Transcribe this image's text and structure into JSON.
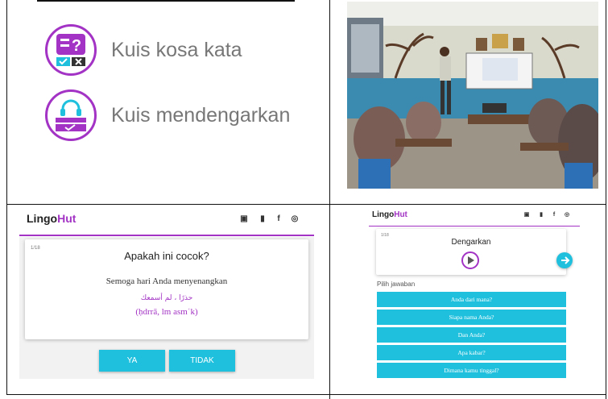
{
  "quiz_menu": {
    "items": [
      {
        "label": "Kuis kosa kata",
        "icon": "vocab-quiz-icon"
      },
      {
        "label": "Kuis mendengarkan",
        "icon": "listening-quiz-icon"
      }
    ]
  },
  "left_app": {
    "logo_main": "Lingo",
    "logo_accent": "Hut",
    "social": [
      "camera-icon",
      "youtube-icon",
      "facebook-icon",
      "instagram-icon"
    ],
    "counter": "1/18",
    "question": "Apakah ini cocok?",
    "phrase": "Semoga hari Anda menyenangkan",
    "arabic": "حذرًا ، لم أسمعك",
    "transliteration": "(ḥdrrā, lm asmʿk)",
    "yes_label": "YA",
    "no_label": "TIDAK"
  },
  "right_app": {
    "logo_main": "Lingo",
    "logo_accent": "Hut",
    "counter": "1/18",
    "prompt": "Dengarkan",
    "choose_label": "Pilih jawaban",
    "answers": [
      "Anda dari mana?",
      "Siapa nama Anda?",
      "Dan Anda?",
      "Apa kabar?",
      "Dimana kamu tinggal?"
    ]
  },
  "colors": {
    "accent_purple": "#a233c4",
    "button_cyan": "#1ec0dd",
    "border": "#111111"
  }
}
